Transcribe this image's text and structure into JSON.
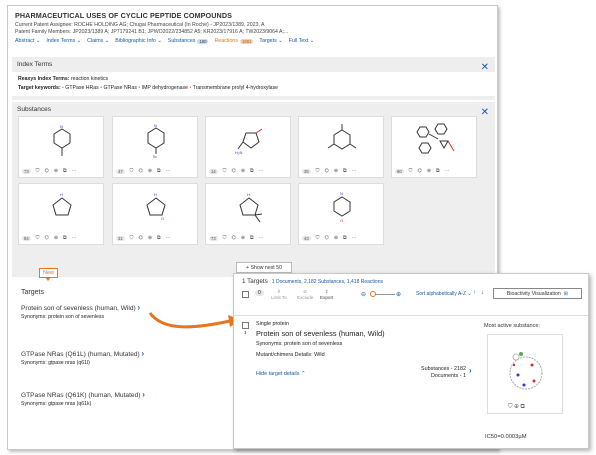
{
  "header": {
    "title": "PHARMACEUTICAL USES OF CYCLIC PEPTIDE COMPOUNDS",
    "assignee": "Current Patent Assignee: ROCHE HOLDING AG; Chugai Pharmaceutical (In Roche) - JP2023/1389, 2023, A",
    "family": "Patent Family Members: JP2023/1389 A; JP7179241 B1; JPWO2022/234852 A5; KR2023/17916 A; TW2023/9064 A;..."
  },
  "nav": [
    {
      "label": "Abstract",
      "chev": true
    },
    {
      "label": "Index Terms",
      "chev": true
    },
    {
      "label": "Claims",
      "chev": true
    },
    {
      "label": "Bibliographic Info",
      "chev": true
    },
    {
      "label": "Substances",
      "badge": "180"
    },
    {
      "label": "Reactions",
      "badge": "1691",
      "active": true
    },
    {
      "label": "Targets",
      "chev": true
    },
    {
      "label": "Full Text",
      "chev": true
    }
  ],
  "index_terms": {
    "title": "Index Terms",
    "reaxys_label": "Reaxys Index Terms:",
    "reaxys_value": " reaction kinetics",
    "target_label": "Target keywords:",
    "target_keywords": [
      "GTPase HRas",
      "GTPase NRas",
      "IMP dehydrogenase",
      "Transmembrane prolyl 4-hydroxylase"
    ]
  },
  "substances": {
    "title": "Substances",
    "counts": [
      "73",
      "47",
      "14",
      "35",
      "90",
      "84",
      "31",
      "73",
      "43"
    ],
    "more_icon": "···",
    "show_next": "+ Show next 50"
  },
  "new_tag": "New",
  "targets": {
    "title": "Targets",
    "items": [
      {
        "name": "Protein son of sevenless (human, Wild)",
        "synonyms": "Synonyms: protein son of sevenless"
      },
      {
        "name": "GTPase NRas (Q61L) (human, Mutated)",
        "synonyms": "Synonyms: gtpase nras (q61l)"
      },
      {
        "name": "GTPase NRas (Q61K) (human, Mutated)",
        "synonyms": "Synonyms: gtpase nras (q61k)"
      }
    ]
  },
  "panel": {
    "count_title": "1 Targets",
    "links": "1 Documents, 2,182 Substances, 1,418 Reactions",
    "selected_count": "0",
    "tools": [
      "Limit To",
      "Exclude",
      "Export"
    ],
    "sort": "Sort alphabetically A-Z",
    "bioactivity": "Bioactivity Visualization",
    "type": "Single protein",
    "name": "Protein son of sevenless (human, Wild)",
    "synonyms": "Synonyms: protein son of sevenless",
    "mutant": "Mutant/chimera Details: Wild",
    "hide": "Hide target details",
    "subs": "Substances - 2182",
    "docs": "Documents - 1",
    "most_active": "Most active substance:",
    "ic50": "IC50=0.0003µM",
    "row_index": "1"
  },
  "colors": {
    "link": "#1a5aa6",
    "accent": "#e07a20"
  }
}
